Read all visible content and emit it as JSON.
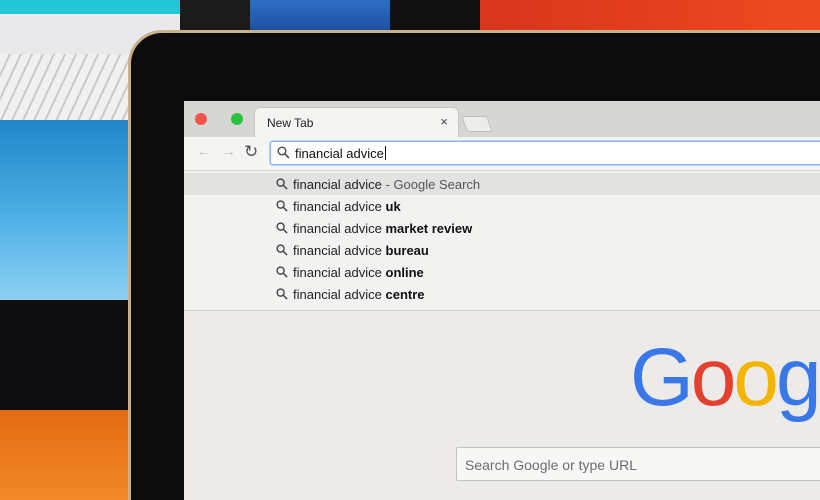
{
  "browser": {
    "tab_title": "New Tab",
    "tab_close": "×",
    "nav": {
      "back": "←",
      "forward": "→",
      "reload": "↻"
    },
    "omnibox_value": "financial advice"
  },
  "suggestions": [
    {
      "prefix": "financial advice",
      "suffix": " - Google Search",
      "style": "gray",
      "selected": true
    },
    {
      "prefix": "financial advice ",
      "suffix": "uk",
      "style": "bold",
      "selected": false
    },
    {
      "prefix": "financial advice ",
      "suffix": "market review",
      "style": "bold",
      "selected": false
    },
    {
      "prefix": "financial advice ",
      "suffix": "bureau",
      "style": "bold",
      "selected": false
    },
    {
      "prefix": "financial advice ",
      "suffix": "online",
      "style": "bold",
      "selected": false
    },
    {
      "prefix": "financial advice ",
      "suffix": "centre",
      "style": "bold",
      "selected": false
    }
  ],
  "page": {
    "logo_letters": [
      {
        "ch": "G",
        "color": "blue"
      },
      {
        "ch": "o",
        "color": "red"
      },
      {
        "ch": "o",
        "color": "yellow"
      },
      {
        "ch": "g",
        "color": "blue"
      }
    ],
    "search_placeholder": "Search Google or type URL"
  },
  "icons": {
    "search": "magnifier-icon",
    "close": "close-icon",
    "reload": "reload-icon"
  },
  "colors": {
    "google_blue": "#3b78e7",
    "google_red": "#e2412f",
    "google_yellow": "#f4b400",
    "mac_close": "#f0554a",
    "mac_zoom": "#2ac33f"
  }
}
